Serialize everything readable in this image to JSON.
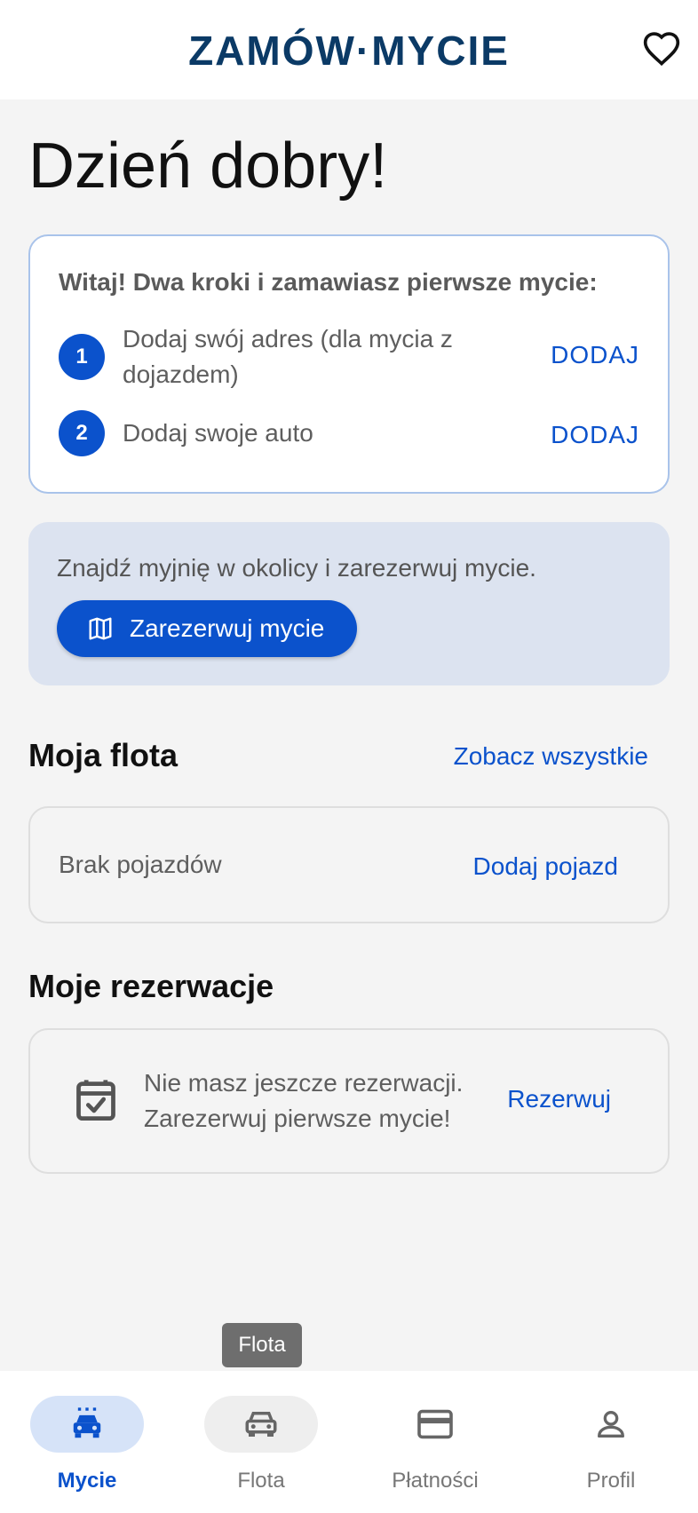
{
  "header": {
    "logo": "ZAMÓW·MYCIE",
    "favorite_icon": "heart-outline-icon"
  },
  "greeting": "Dzień dobry!",
  "onboarding": {
    "title": "Witaj! Dwa kroki i zamawiasz pierwsze mycie:",
    "steps": [
      {
        "number": "1",
        "text": "Dodaj swój adres (dla mycia z dojazdem)",
        "action": "DODAJ"
      },
      {
        "number": "2",
        "text": "Dodaj swoje auto",
        "action": "DODAJ"
      }
    ]
  },
  "promo": {
    "text": "Znajdź myjnię w okolicy i zarezerwuj mycie.",
    "button_label": "Zarezerwuj mycie",
    "button_icon": "map-icon"
  },
  "fleet": {
    "title": "Moja flota",
    "see_all": "Zobacz wszystkie",
    "empty_text": "Brak pojazdów",
    "empty_action": "Dodaj pojazd"
  },
  "reservations": {
    "title": "Moje rezerwacje",
    "empty_line1": "Nie masz jeszcze rezerwacji.",
    "empty_line2": "Zarezerwuj pierwsze mycie!",
    "empty_action": "Rezerwuj",
    "icon": "calendar-check-icon"
  },
  "tooltip": "Flota",
  "bottom_nav": {
    "active": "Mycie",
    "items": [
      {
        "label": "Mycie",
        "icon": "car-wash-icon"
      },
      {
        "label": "Flota",
        "icon": "car-icon"
      },
      {
        "label": "Płatności",
        "icon": "credit-card-icon"
      },
      {
        "label": "Profil",
        "icon": "person-icon"
      }
    ]
  },
  "colors": {
    "primary": "#0b52cc",
    "logo": "#0b3a66",
    "background": "#f4f4f4",
    "promo_bg": "#dce3f0",
    "active_pill": "#d6e3f8"
  }
}
